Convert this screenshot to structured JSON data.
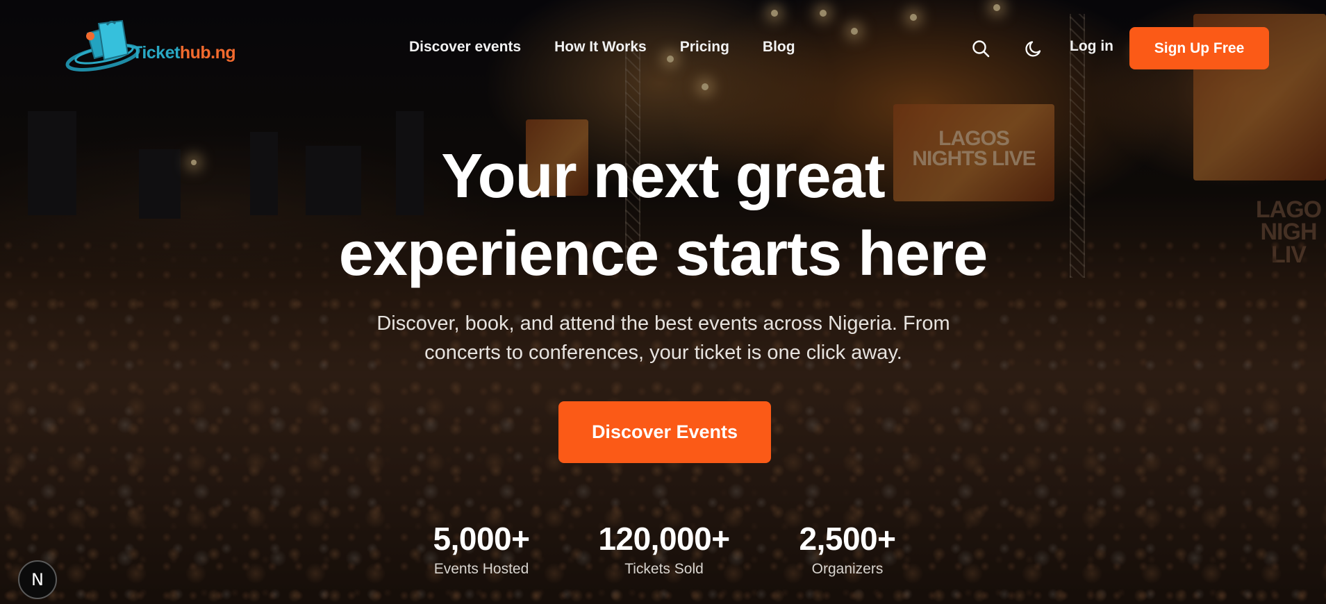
{
  "brand": {
    "logo_text_primary": "Ticket",
    "logo_text_secondary": "hub.ng",
    "colors": {
      "teal": "#29a8c4",
      "orange": "#f26a2e",
      "accent": "#fb5a17"
    }
  },
  "nav": {
    "items": [
      {
        "label": "Discover events"
      },
      {
        "label": "How It Works"
      },
      {
        "label": "Pricing"
      },
      {
        "label": "Blog"
      }
    ]
  },
  "header": {
    "search_icon": "search-icon",
    "theme_icon": "moon-icon",
    "login_label": "Log in",
    "signup_label": "Sign Up Free"
  },
  "hero": {
    "title_line1": "Your next great",
    "title_line2": "experience starts here",
    "subtitle_line1": "Discover, book, and attend the best events across Nigeria. From",
    "subtitle_line2": "concerts to conferences, your ticket is one click away.",
    "cta_label": "Discover Events",
    "background_screen_text": "LAGOS NIGHTS LIVE"
  },
  "stats": [
    {
      "value": "5,000+",
      "label": "Events Hosted"
    },
    {
      "value": "120,000+",
      "label": "Tickets Sold"
    },
    {
      "value": "2,500+",
      "label": "Organizers"
    }
  ],
  "dev_badge": {
    "label": "N"
  }
}
